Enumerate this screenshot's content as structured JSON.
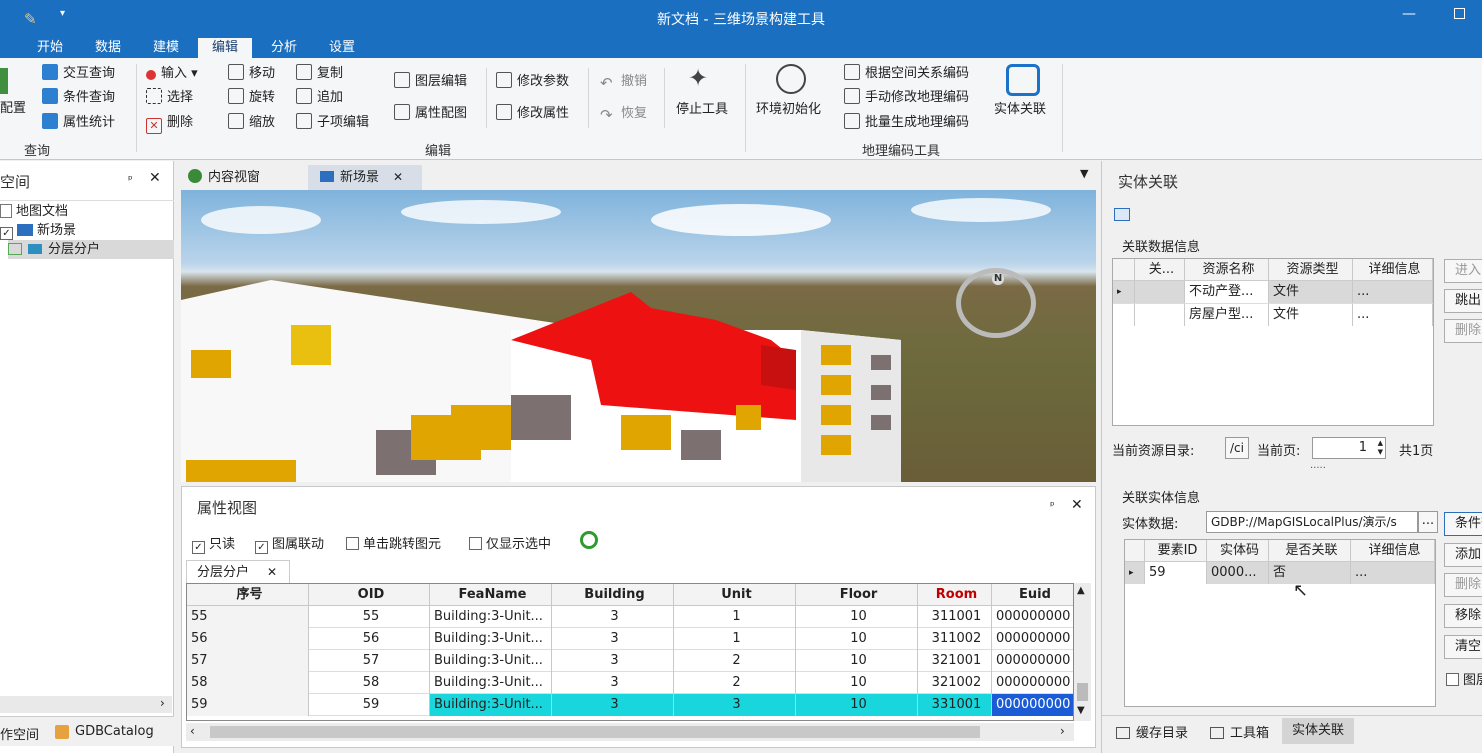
{
  "window": {
    "title": "新文档 - 三维场景构建工具"
  },
  "menu": [
    "开始",
    "数据",
    "建模",
    "编辑",
    "分析",
    "设置"
  ],
  "ribbon": {
    "partial_label": "配置",
    "query": {
      "items": [
        "交互查询",
        "条件查询",
        "属性统计"
      ],
      "group": "查询"
    },
    "edit": {
      "col1": [
        "输入",
        "选择",
        "删除"
      ],
      "col2": [
        "移动",
        "旋转",
        "缩放"
      ],
      "col3": [
        "复制",
        "追加",
        "子项编辑"
      ],
      "col4": [
        "图层编辑",
        "属性配图"
      ],
      "col5": [
        "修改参数",
        "修改属性"
      ],
      "col6": [
        "撤销",
        "恢复"
      ],
      "stop": "停止工具",
      "group": "编辑"
    },
    "geo": {
      "env": "环境初始化",
      "items": [
        "根据空间关系编码",
        "手动修改地理编码",
        "批量生成地理编码"
      ],
      "group": "地理编码工具"
    },
    "entity": "实体关联"
  },
  "workspace": {
    "title": "空间",
    "tree": [
      "地图文档",
      "新场景",
      "分层分户"
    ],
    "tabs": [
      "作空间",
      "GDBCatalog"
    ]
  },
  "doc_tabs": [
    "内容视窗",
    "新场景"
  ],
  "compass": "N",
  "attr": {
    "title": "属性视图",
    "options": [
      "只读",
      "图属联动",
      "单击跳转图元",
      "仅显示选中"
    ],
    "subtab": "分层分户",
    "columns": [
      "序号",
      "OID",
      "FeaName",
      "Building",
      "Unit",
      "Floor",
      "Room",
      "Euid"
    ],
    "rows": [
      [
        "55",
        "55",
        "Building:3-Unit...",
        "3",
        "1",
        "10",
        "311001",
        "000000000"
      ],
      [
        "56",
        "56",
        "Building:3-Unit...",
        "3",
        "1",
        "10",
        "311002",
        "000000000"
      ],
      [
        "57",
        "57",
        "Building:3-Unit...",
        "3",
        "2",
        "10",
        "321001",
        "000000000"
      ],
      [
        "58",
        "58",
        "Building:3-Unit...",
        "3",
        "2",
        "10",
        "321002",
        "000000000"
      ],
      [
        "59",
        "59",
        "Building:3-Unit...",
        "3",
        "3",
        "10",
        "331001",
        "000000000"
      ]
    ]
  },
  "entity": {
    "title": "实体关联",
    "rel_group": "关联数据信息",
    "rel_columns": [
      "关...",
      "资源名称",
      "资源类型",
      "详细信息"
    ],
    "rel_rows": [
      [
        "",
        "不动产登...",
        "文件",
        "..."
      ],
      [
        "",
        "房屋户型...",
        "文件",
        "..."
      ]
    ],
    "rel_buttons": [
      "进入",
      "跳出",
      "删除"
    ],
    "dir_label": "当前资源目录:",
    "dir_btn": "/ci",
    "page_label": "当前页:",
    "page_value": "1",
    "page_total": "共1页",
    "dots": "·····",
    "ent_group": "关联实体信息",
    "data_label": "实体数据:",
    "data_value": "GDBP://MapGISLocalPlus/演示/s",
    "data_btn": "...",
    "ent_columns": [
      "要素ID",
      "实体码",
      "是否关联",
      "详细信息"
    ],
    "ent_rows": [
      [
        "59",
        "0000...",
        "否",
        "..."
      ]
    ],
    "ent_buttons": [
      "条件查",
      "添加",
      "删除",
      "移除",
      "清空"
    ],
    "check_label": "图层"
  },
  "bottom_tabs": [
    "缓存目录",
    "工具箱",
    "实体关联"
  ]
}
